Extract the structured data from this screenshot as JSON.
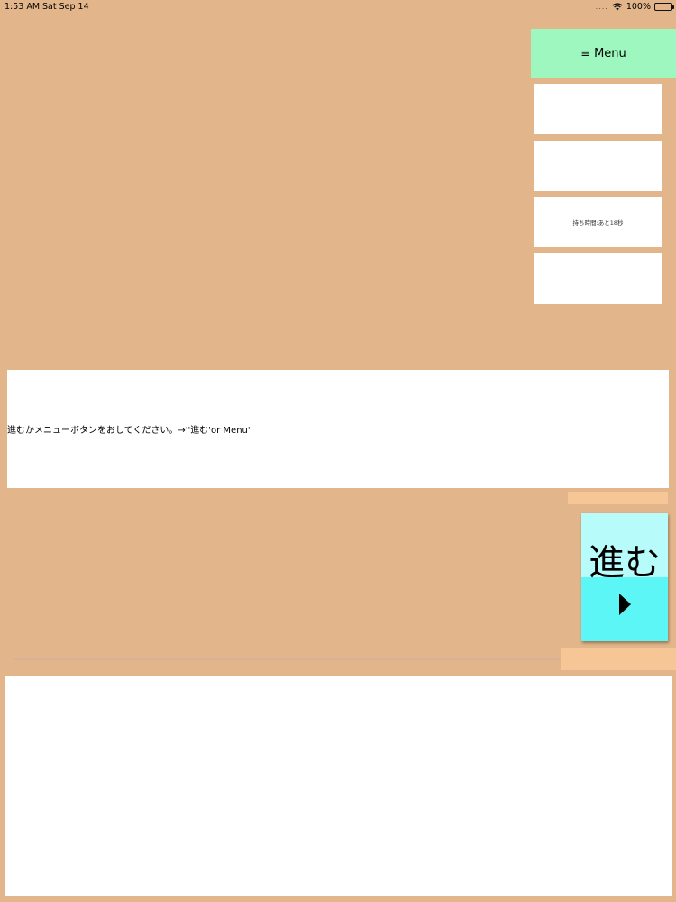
{
  "status_bar": {
    "time": "1:53 AM",
    "date": "Sat Sep 14",
    "signal": "....",
    "battery": "100%"
  },
  "menu": {
    "icon": "≡",
    "label": "Menu"
  },
  "side_panels": {
    "timer_text": "持ち時間:あと18秒"
  },
  "message": {
    "text": "進むかメニューボタンをおしてください。→''進む'or Menu'"
  },
  "next_button": {
    "label": "進む",
    "icon": "play-triangle-icon"
  },
  "colors": {
    "background": "#e2b58a",
    "menu_button": "#9ef7be",
    "next_button_top": "#b7fbfa",
    "next_button_bottom": "#5cf6f6",
    "accent_bar": "#f7c696"
  }
}
